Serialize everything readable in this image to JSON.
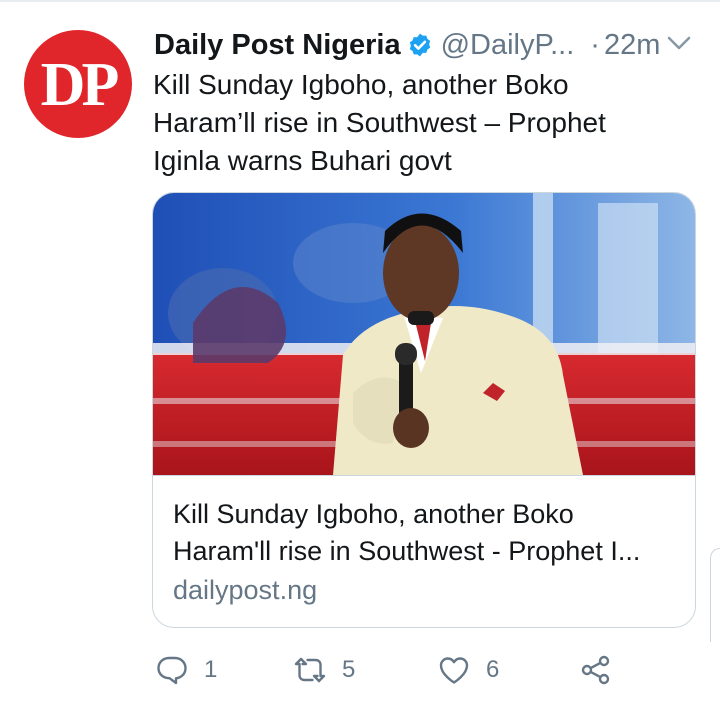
{
  "tweet": {
    "author_name": "Daily Post Nigeria",
    "handle": "@DailyP...",
    "separator": "·",
    "time": "22m",
    "avatar_text": "DP",
    "text_lines": [
      "Kill Sunday Igboho, another Boko",
      "Haram’ll rise in Southwest – Prophet",
      "Iginla warns Buhari govt"
    ]
  },
  "card": {
    "title_lines": [
      "Kill Sunday Igboho, another Boko",
      "Haram'll rise in Southwest - Prophet I..."
    ],
    "domain": "dailypost.ng"
  },
  "actions": {
    "reply_count": "1",
    "retweet_count": "5",
    "like_count": "6"
  },
  "colors": {
    "avatar_bg": "#e0262b",
    "verified": "#1da1f2",
    "secondary_text": "#657786",
    "border": "#ccd6dd"
  },
  "icons": [
    "verified-badge-icon",
    "chevron-down-icon",
    "reply-icon",
    "retweet-icon",
    "like-icon",
    "share-icon"
  ]
}
